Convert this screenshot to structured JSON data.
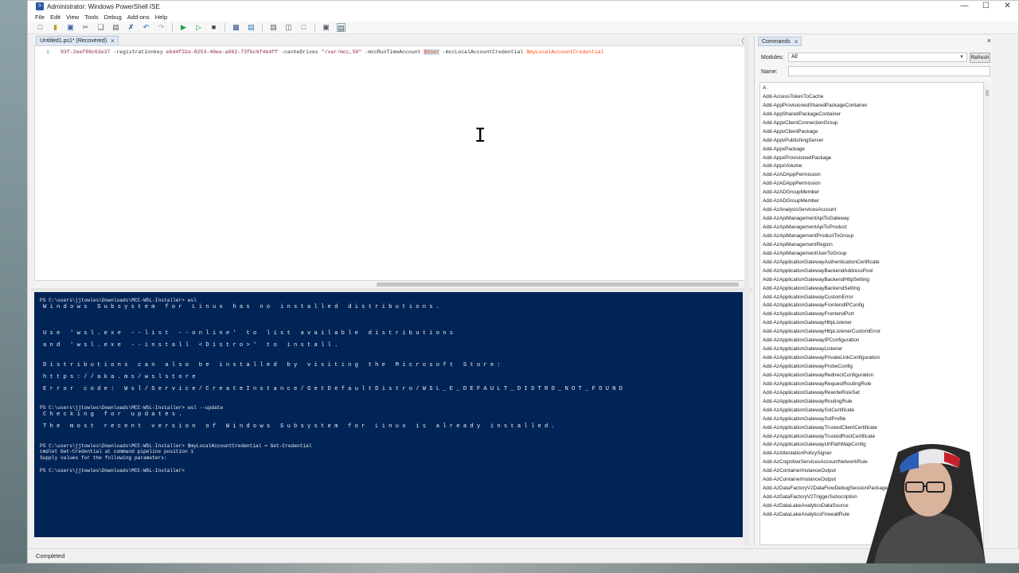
{
  "window": {
    "title": "Administrator: Windows PowerShell ISE",
    "app_icon_glyph": ">"
  },
  "window_controls": {
    "minimize": "—",
    "maximize": "☐",
    "close": "✕"
  },
  "menu": [
    "File",
    "Edit",
    "View",
    "Tools",
    "Debug",
    "Add-ons",
    "Help"
  ],
  "toolbar": {
    "icons": [
      "new-icon",
      "open-icon",
      "save-icon",
      "cut-icon",
      "copy-icon",
      "paste-icon",
      "clear-icon",
      "undo-icon",
      "redo-icon",
      "run-icon",
      "run-selection-icon",
      "stop-icon",
      "remote-icon",
      "start-powershell-icon",
      "show-script-pane-top-icon",
      "show-script-pane-right-icon",
      "show-script-pane-max-icon",
      "show-command-window-icon",
      "show-command-addon-icon"
    ]
  },
  "editor": {
    "tab": {
      "label": "Untitled1.ps1* (Recovered)",
      "close": "×"
    },
    "line_number": "1",
    "code": {
      "t1": "93f-2eef89c63e37",
      "t2": " -registrationkey ",
      "t3": "e6d4f32e-8253-40ee-a002-73fbc6f4b4ff",
      "t4": " -cacheDrives ",
      "t5": "\"/var/mcc,50\"",
      "t6": " -mccRunTimeAccount ",
      "t7": "$User",
      "t8": " -mccLocalAccountCredential ",
      "t9": "$myLocalAccountCredential"
    },
    "ibeam": "I"
  },
  "console": {
    "lines": [
      {
        "text": "PS C:\\users\\jjtowles\\Downloads\\MCC-WSL-Installer> wsl",
        "style": "normal"
      },
      {
        "text": "Windows Subsystem for Linux has no installed distributions.",
        "style": "wide"
      },
      {
        "text": "",
        "style": "blank"
      },
      {
        "text": "",
        "style": "blank"
      },
      {
        "text": "Use 'wsl.exe --list --online' to list available distributions",
        "style": "wide"
      },
      {
        "text": "and 'wsl.exe --install <Distro>' to install.",
        "style": "wide"
      },
      {
        "text": "",
        "style": "blank"
      },
      {
        "text": "Distributions can also be installed by visiting the Microsoft Store:",
        "style": "wide"
      },
      {
        "text": "https://aka.ms/wslstore",
        "style": "wide"
      },
      {
        "text": "Error code: Wsl/Service/CreateInstance/GetDefaultDistro/WSL_E_DEFAULT_DISTRO_NOT_FOUND",
        "style": "wide"
      },
      {
        "text": "",
        "style": "blank"
      },
      {
        "text": "PS C:\\users\\jjtowles\\Downloads\\MCC-WSL-Installer> wsl --update",
        "style": "normal"
      },
      {
        "text": "Checking for updates.",
        "style": "wide"
      },
      {
        "text": "The most recent version of Windows Subsystem for Linux is already installed.",
        "style": "wide"
      },
      {
        "text": "",
        "style": "blank"
      },
      {
        "text": "PS C:\\users\\jjtowles\\Downloads\\MCC-WSL-Installer> $myLocalAccountCredential = Get-Credential",
        "style": "normal"
      },
      {
        "text": "cmdlet Get-Credential at command pipeline position 1",
        "style": "normal"
      },
      {
        "text": "Supply values for the following parameters:",
        "style": "normal"
      },
      {
        "text": "",
        "style": "blank"
      },
      {
        "text": "PS C:\\users\\jjtowles\\Downloads\\MCC-WSL-Installer>",
        "style": "normal"
      }
    ]
  },
  "status": {
    "text": "Completed"
  },
  "commands_panel": {
    "tab_label": "Commands",
    "tab_close": "×",
    "panel_close": "×",
    "modules_label": "Modules:",
    "modules_value": "All",
    "refresh_label": "Refresh",
    "name_label": "Name:",
    "name_value": "",
    "items": [
      "A:",
      "Add-AccessTokenToCache",
      "Add-AppProvisionedSharedPackageContainer",
      "Add-AppSharedPackageContainer",
      "Add-AppvClientConnectionGroup",
      "Add-AppvClientPackage",
      "Add-AppvPublishingServer",
      "Add-AppxPackage",
      "Add-AppxProvisionedPackage",
      "Add-AppxVolume",
      "Add-AzADAppPermission",
      "Add-AzADAppPermission",
      "Add-AzADGroupMember",
      "Add-AzADGroupMember",
      "Add-AzAnalysisServicesAccount",
      "Add-AzApiManagementApiToGateway",
      "Add-AzApiManagementApiToProduct",
      "Add-AzApiManagementProductToGroup",
      "Add-AzApiManagementRegion",
      "Add-AzApiManagementUserToGroup",
      "Add-AzApplicationGatewayAuthenticationCertificate",
      "Add-AzApplicationGatewayBackendAddressPool",
      "Add-AzApplicationGatewayBackendHttpSetting",
      "Add-AzApplicationGatewayBackendSetting",
      "Add-AzApplicationGatewayCustomError",
      "Add-AzApplicationGatewayFrontendIPConfig",
      "Add-AzApplicationGatewayFrontendPort",
      "Add-AzApplicationGatewayHttpListener",
      "Add-AzApplicationGatewayHttpListenerCustomError",
      "Add-AzApplicationGatewayIPConfiguration",
      "Add-AzApplicationGatewayListener",
      "Add-AzApplicationGatewayPrivateLinkConfiguration",
      "Add-AzApplicationGatewayProbeConfig",
      "Add-AzApplicationGatewayRedirectConfiguration",
      "Add-AzApplicationGatewayRequestRoutingRule",
      "Add-AzApplicationGatewayRewriteRuleSet",
      "Add-AzApplicationGatewayRoutingRule",
      "Add-AzApplicationGatewaySslCertificate",
      "Add-AzApplicationGatewaySslProfile",
      "Add-AzApplicationGatewayTrustedClientCertificate",
      "Add-AzApplicationGatewayTrustedRootCertificate",
      "Add-AzApplicationGatewayUrlPathMapConfig",
      "Add-AzAttestationPolicySigner",
      "Add-AzCognitiveServicesAccountNetworkRule",
      "Add-AzContainerInstanceOutput",
      "Add-AzContainerInstanceOutput",
      "Add-AzDataFactoryV2DataFlowDebugSessionPackage",
      "Add-AzDataFactoryV2TriggerSubscription",
      "Add-AzDataLakeAnalyticsDataSource",
      "Add-AzDataLakeAnalyticsFirewallRule"
    ]
  },
  "colors": {
    "console_bg": "#012456",
    "console_fg": "#eeedf0",
    "selection": "#c6dbf0"
  }
}
